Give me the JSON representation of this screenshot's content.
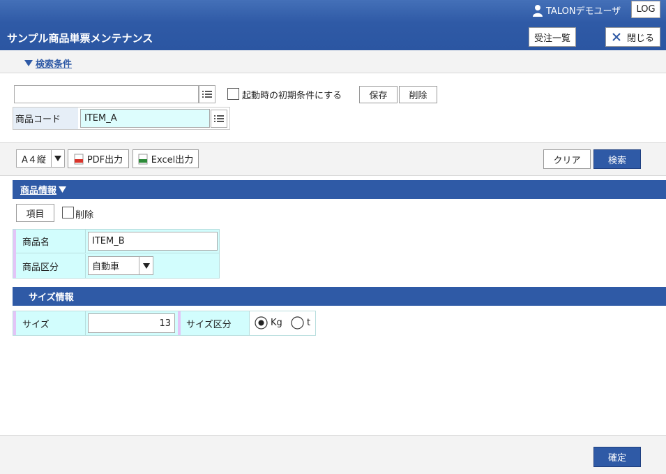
{
  "header": {
    "title": "サンプル商品単票メンテナンス",
    "user_name": "TALONデモユーザ",
    "log_label": "LOG",
    "order_list_label": "受注一覧",
    "close_label": "閉じる"
  },
  "search": {
    "toggle_label": "検索条件",
    "condition_value": "",
    "startup_default_label": "起動時の初期条件にする",
    "save_label": "保存",
    "delete_label": "削除",
    "product_code_label": "商品コード",
    "product_code_value": "ITEM_A"
  },
  "toolbar": {
    "paper_select": "A４縦",
    "pdf_label": "PDF出力",
    "excel_label": "Excel出力",
    "clear_label": "クリア",
    "search_label": "検索"
  },
  "product_section": {
    "title": "商品情報",
    "item_button_label": "項目",
    "delete_label": "削除",
    "name_label": "商品名",
    "name_value": "ITEM_B",
    "category_label": "商品区分",
    "category_value": "自動車"
  },
  "size_section": {
    "title": "サイズ情報",
    "size_label": "サイズ",
    "size_value": "13",
    "size_unit_label": "サイズ区分",
    "unit_options": [
      "Kg",
      "t"
    ],
    "unit_selected": "Kg"
  },
  "footer": {
    "confirm_label": "確定"
  },
  "colors": {
    "header_blue": "#2f5aa6",
    "cell_cyan": "#d2fdfd",
    "accent_pink": "#e3c4f7"
  }
}
